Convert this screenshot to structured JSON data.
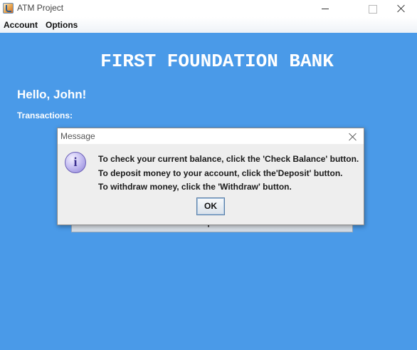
{
  "window": {
    "title": "ATM Project",
    "icon": "java-cup-icon",
    "controls": [
      "minimize",
      "maximize",
      "close"
    ]
  },
  "menu": {
    "account": "Account",
    "options": "Options"
  },
  "main": {
    "background_color": "#4a9ae8",
    "bank_title": "FIRST FOUNDATION BANK",
    "greeting": "Hello, John!",
    "transactions_label": "Transactions:",
    "deposit_button": "Deposit"
  },
  "dialog": {
    "title": "Message",
    "icon": "info-icon",
    "icon_glyph": "i",
    "lines": [
      "To check your current balance, click the 'Check Balance' button.",
      "To deposit money to your account, click the'Deposit' button.",
      "To withdraw money, click the 'Withdraw' button."
    ],
    "ok_label": "OK"
  }
}
